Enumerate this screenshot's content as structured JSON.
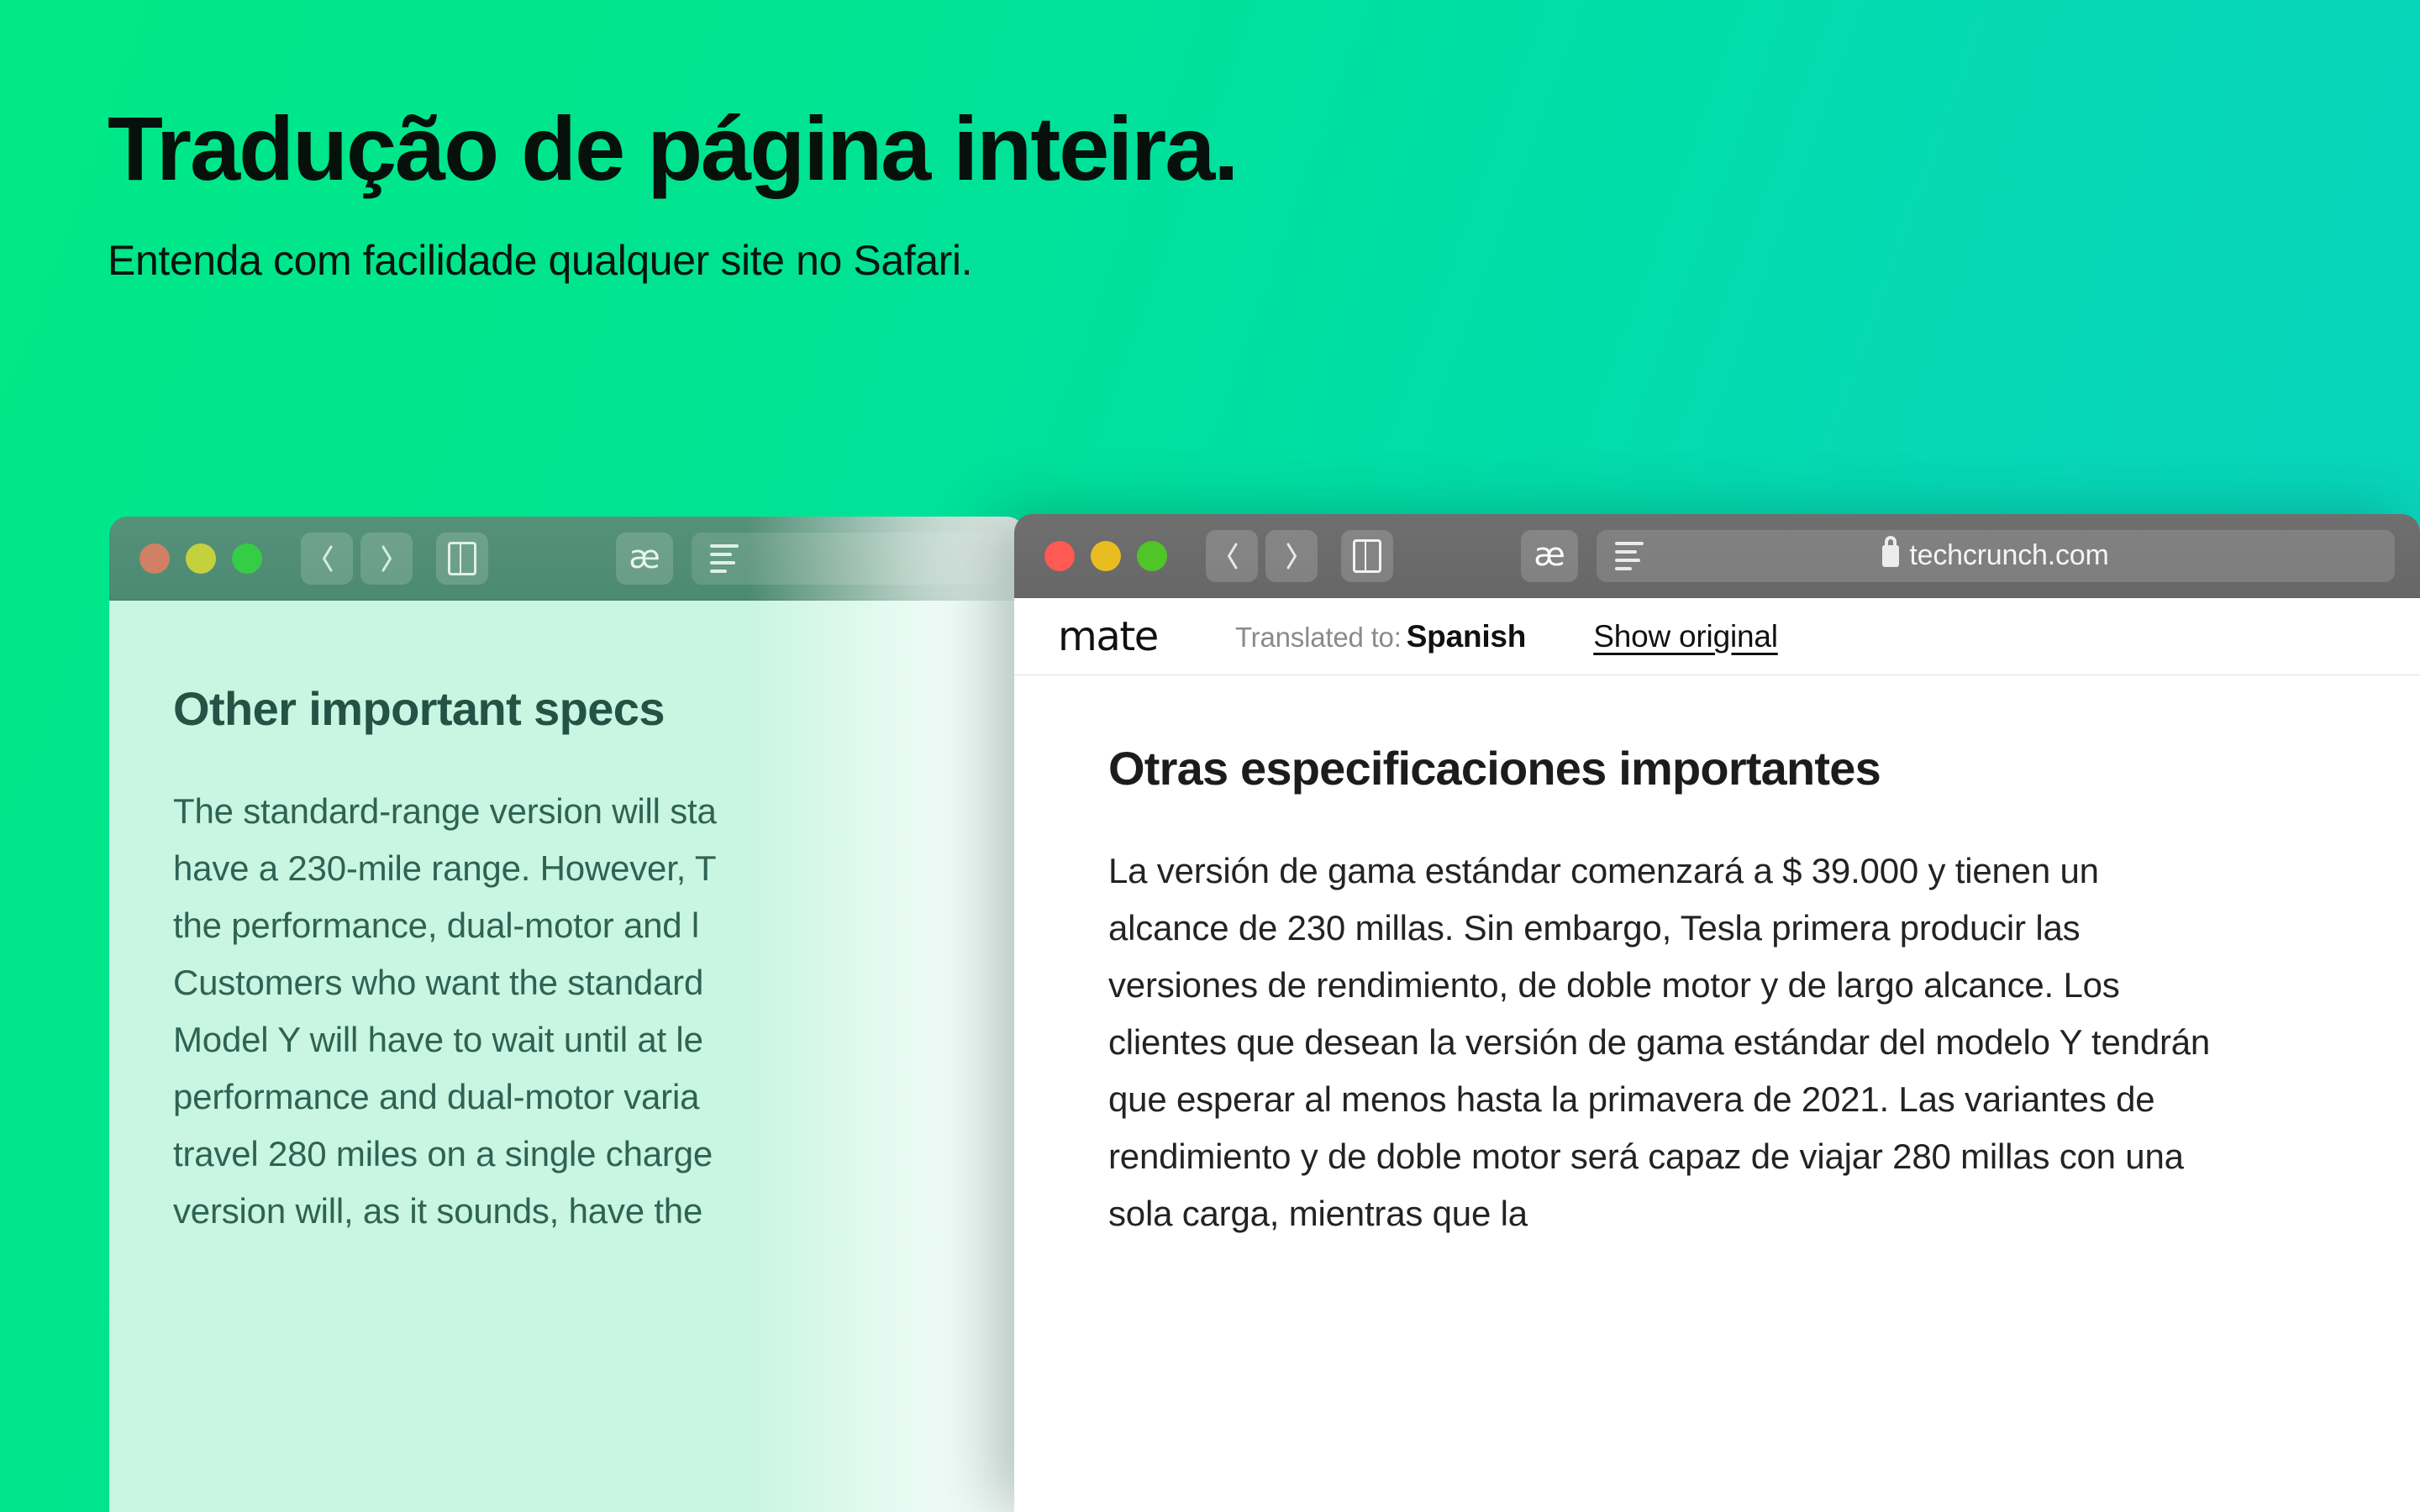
{
  "hero": {
    "title": "Tradução de página inteira.",
    "subtitle": "Entenda com facilidade qualquer site no Safari."
  },
  "colors": {
    "background_start": "#00e887",
    "background_end": "#0ad3c0",
    "traffic_red": "#fc5a52",
    "traffic_yellow": "#e9bd21",
    "traffic_green": "#4fc527",
    "original_page_bg": "#c9f5e3",
    "translated_page_bg": "#ffffff"
  },
  "original_window": {
    "toolbar": {
      "back_label": "Back",
      "forward_label": "Forward",
      "sidebar_label": "Show Sidebar",
      "reader_size_label": "æ",
      "reader_label": "Reader",
      "address_value": ""
    },
    "page": {
      "heading": "Other important specs",
      "paragraph_lines": [
        "The standard-range version will sta",
        "have a 230-mile range. However, T",
        "the performance, dual-motor and l",
        "Customers who want the standard",
        "Model Y will have to wait until at le",
        "performance and dual-motor varia",
        "travel 280 miles on a single charge",
        "version will, as it sounds, have the"
      ]
    }
  },
  "translated_window": {
    "toolbar": {
      "back_label": "Back",
      "forward_label": "Forward",
      "sidebar_label": "Show Sidebar",
      "reader_size_label": "æ",
      "reader_label": "Reader",
      "address_value": "techcrunch.com",
      "secure_icon": "lock-icon"
    },
    "mate_bar": {
      "logo": "mate",
      "status_prefix": "Translated to:",
      "language": "Spanish",
      "show_original_label": "Show original"
    },
    "page": {
      "heading": "Otras especificaciones importantes",
      "paragraph": "La versión de gama estándar comenzará a $ 39.000 y tienen un alcance de 230 millas. Sin embargo, Tesla primera producir las versiones de rendimiento, de doble motor y de largo alcance. Los clientes que desean la versión de gama estándar del modelo Y tendrán que esperar al menos hasta la primavera de 2021. Las variantes de rendimiento y de doble motor será capaz de viajar 280 millas con una sola carga, mientras que la"
    }
  }
}
